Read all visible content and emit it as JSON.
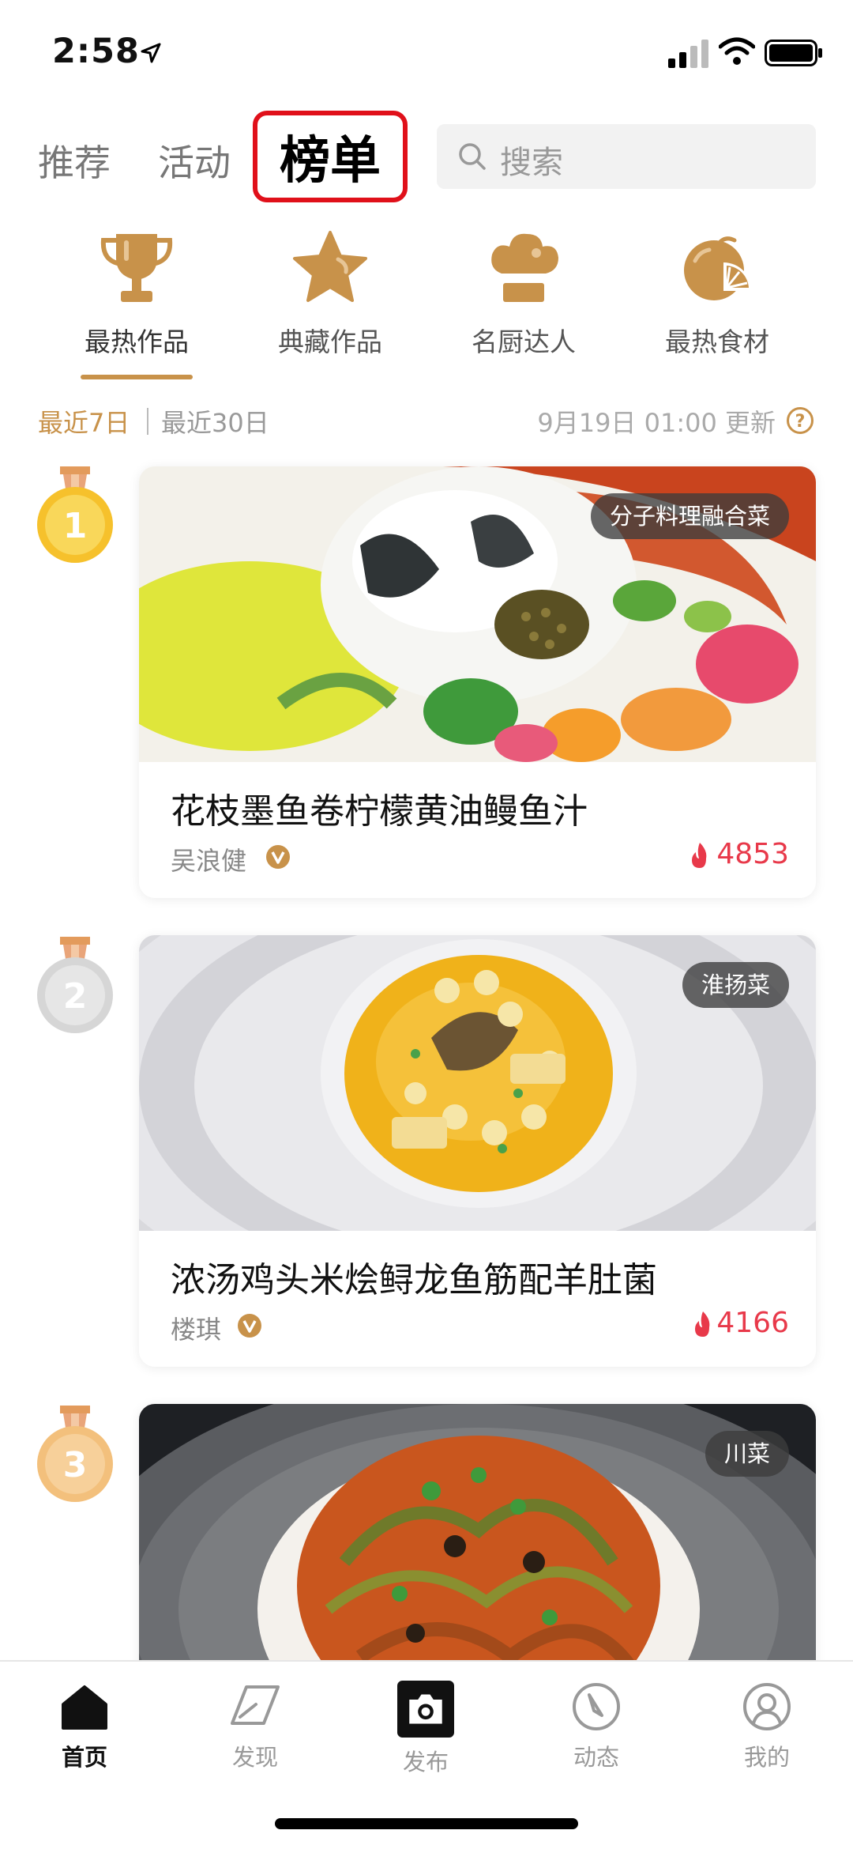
{
  "status_bar": {
    "time": "2:58"
  },
  "top_nav": {
    "tabs": [
      {
        "label": "推荐"
      },
      {
        "label": "活动"
      },
      {
        "label": "榜单"
      }
    ],
    "search": {
      "placeholder": "搜索"
    }
  },
  "categories": [
    {
      "label": "最热作品",
      "icon": "trophy-icon",
      "active": true
    },
    {
      "label": "典藏作品",
      "icon": "star-icon",
      "active": false
    },
    {
      "label": "名厨达人",
      "icon": "chef-hat-icon",
      "active": false
    },
    {
      "label": "最热食材",
      "icon": "lemon-icon",
      "active": false
    }
  ],
  "filter": {
    "options": [
      "最近7日",
      "最近30日"
    ],
    "selected": "最近7日",
    "update_time": "9月19日 01:00 更新"
  },
  "ranking": [
    {
      "rank": "1",
      "title": "花枝墨鱼卷柠檬黄油鳗鱼汁",
      "chef": "吴浪健",
      "heat": "4853",
      "cuisine": "分子料理融合菜"
    },
    {
      "rank": "2",
      "title": "浓汤鸡头米烩鲟龙鱼筋配羊肚菌",
      "chef": "楼琪",
      "heat": "4166",
      "cuisine": "淮扬菜"
    },
    {
      "rank": "3",
      "title": "",
      "chef": "",
      "heat": "",
      "cuisine": "川菜"
    }
  ],
  "tab_bar": {
    "tabs": [
      {
        "label": "首页",
        "icon": "home-icon",
        "active": true
      },
      {
        "label": "发现",
        "icon": "discover-icon",
        "active": false
      },
      {
        "label": "发布",
        "icon": "camera-icon",
        "active": false
      },
      {
        "label": "动态",
        "icon": "compass-icon",
        "active": false
      },
      {
        "label": "我的",
        "icon": "profile-icon",
        "active": false
      }
    ]
  },
  "colors": {
    "accent": "#c8924a",
    "highlight_border": "#e0101a",
    "heat": "#e8394a",
    "gold": "#f6c12c",
    "silver": "#d6d6d6",
    "bronze": "#f3c07c"
  }
}
